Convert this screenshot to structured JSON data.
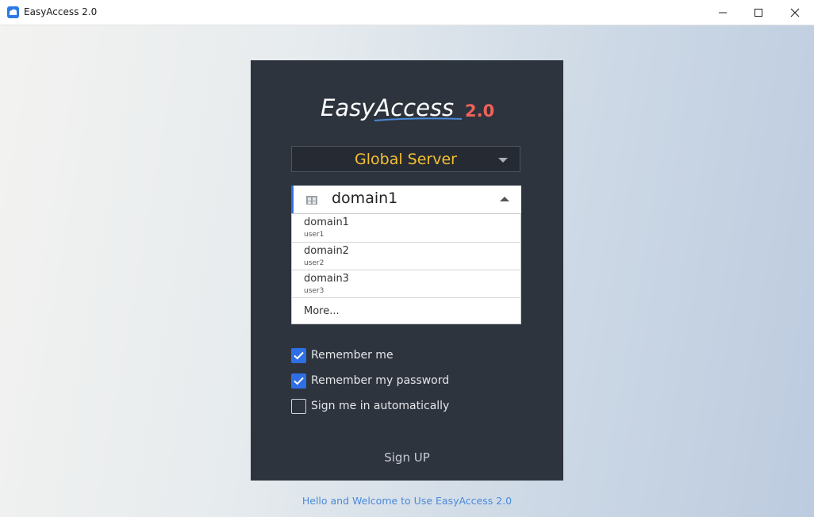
{
  "window": {
    "title": "EasyAccess 2.0"
  },
  "logo": {
    "main_text": "EasyAccess",
    "version_text": "2.0"
  },
  "server_select": {
    "value": "Global Server"
  },
  "domain_select": {
    "value": "domain1",
    "options": [
      {
        "domain": "domain1",
        "user": "user1"
      },
      {
        "domain": "domain2",
        "user": "user2"
      },
      {
        "domain": "domain3",
        "user": "user3"
      }
    ],
    "more_label": "More..."
  },
  "checkboxes": {
    "remember_me": {
      "label": "Remember me",
      "checked": true
    },
    "remember_password": {
      "label": "Remember my password",
      "checked": true
    },
    "auto_sign_in": {
      "label": "Sign me in automatically",
      "checked": false
    }
  },
  "sign_up_label": "Sign UP",
  "footer_text": "Hello and Welcome to Use EasyAccess 2.0",
  "colors": {
    "accent": "#2f6fe6",
    "server_text": "#f5bf32",
    "panel": "#2e343e",
    "logo_version": "#f0625a"
  },
  "icons": {
    "app": "app-icon",
    "domain": "domain-icon",
    "server_caret": "chevron-down-icon",
    "domain_caret": "chevron-up-icon"
  }
}
